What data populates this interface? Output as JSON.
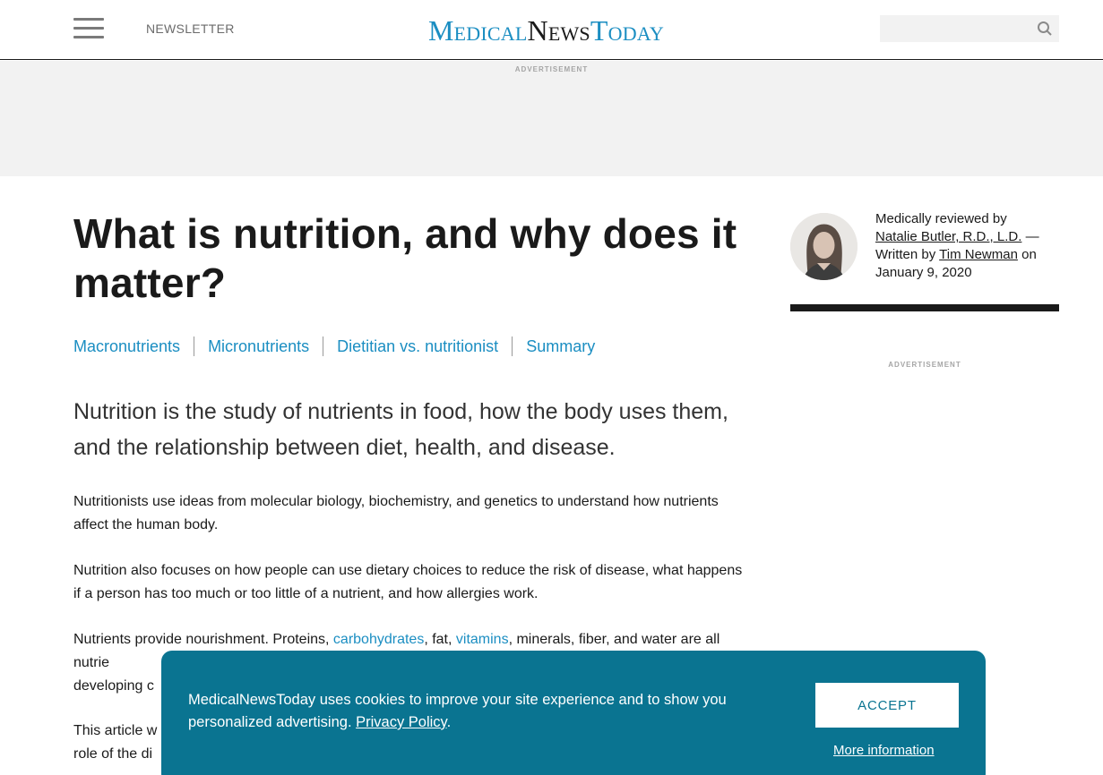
{
  "header": {
    "newsletter": "NEWSLETTER",
    "logo": {
      "part1": "Medical",
      "part2": "News",
      "part3": "Today"
    },
    "search_placeholder": ""
  },
  "ad_top": {
    "label": "ADVERTISEMENT"
  },
  "article": {
    "title": "What is nutrition, and why does it matter?",
    "toc": [
      "Macronutrients",
      "Micronutrients",
      "Dietitian vs. nutritionist",
      "Summary"
    ],
    "lede": "Nutrition is the study of nutrients in food, how the body uses them, and the relationship between diet, health, and disease.",
    "p1": "Nutritionists use ideas from molecular biology, biochemistry, and genetics to understand how nutrients affect the human body.",
    "p2": "Nutrition also focuses on how people can use dietary choices to reduce the risk of disease, what happens if a person has too much or too little of a nutrient, and how allergies work.",
    "p3": {
      "a": "Nutrients provide nourishment. Proteins, ",
      "link1": "carbohydrates",
      "b": ", fat, ",
      "link2": "vitamins",
      "c": ", minerals, fiber, and water are all nutrie",
      "d": "developing c"
    },
    "p4": {
      "a": "This article w",
      "b": "role of the di"
    }
  },
  "byline": {
    "reviewed_prefix": "Medically reviewed by",
    "reviewer": "Natalie Butler, R.D., L.D.",
    "dash": " —",
    "written_prefix": "Written by ",
    "author": "Tim Newman",
    "on": " on",
    "date": "January 9, 2020"
  },
  "ad_side": {
    "label": "ADVERTISEMENT"
  },
  "cookie": {
    "text": "MedicalNewsToday uses cookies to improve your site experience and to show you personalized advertising. ",
    "policy_link": "Privacy Policy",
    "period": ".",
    "accept": "ACCEPT",
    "more": "More information"
  },
  "colors": {
    "brand": "#1b8ec2",
    "banner": "#0a7491"
  }
}
